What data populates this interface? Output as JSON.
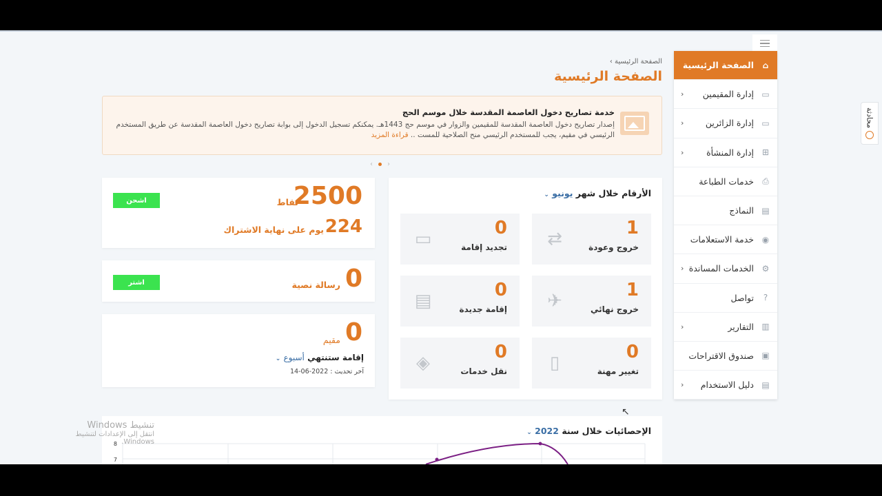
{
  "sidebar": {
    "items": [
      {
        "label": "الصفحة الرئيسية",
        "icon": "home-icon",
        "active": true,
        "chevron": false
      },
      {
        "label": "إدارة المقيمين",
        "icon": "id-card-icon",
        "chevron": true
      },
      {
        "label": "إدارة الزائرين",
        "icon": "id-card-icon",
        "chevron": true
      },
      {
        "label": "إدارة المنشأة",
        "icon": "org-chart-icon",
        "chevron": true
      },
      {
        "label": "خدمات الطباعة",
        "icon": "printer-icon",
        "chevron": false
      },
      {
        "label": "النماذج",
        "icon": "document-icon",
        "chevron": false
      },
      {
        "label": "خدمة الاستعلامات",
        "icon": "eye-icon",
        "chevron": false
      },
      {
        "label": "الخدمات المساندة",
        "icon": "gears-icon",
        "chevron": true
      },
      {
        "label": "تواصل",
        "icon": "question-icon",
        "chevron": false
      },
      {
        "label": "التقارير",
        "icon": "bar-chart-icon",
        "chevron": true
      },
      {
        "label": "صندوق الاقتراحات",
        "icon": "inbox-icon",
        "chevron": false
      },
      {
        "label": "دليل الاستخدام",
        "icon": "book-icon",
        "chevron": true
      }
    ]
  },
  "sidetab": {
    "label": "محادثة"
  },
  "header": {
    "breadcrumb": "الصفحة الرئيسية",
    "breadcrumb_sep": "›",
    "title": "الصفحة الرئيسية"
  },
  "banner": {
    "title": "خدمة تصاريح دخول العاصمة المقدسة خلال موسم الحج",
    "text": "إصدار تصاريح دخول العاصمة المقدسة للمقيمين والزوار في موسم حج 1443هـ. يمكنكم تسجيل الدخول إلى بوابة تصاريح دخول العاصمة المقدسة عن طريق المستخدم الرئيسي في مقيم، يجب للمستخدم الرئيسي منح الصلاحية للمست .. ",
    "more": "قراءة المزيد"
  },
  "points_card": {
    "points": "2500",
    "points_unit": "نقاط",
    "days": "224",
    "days_label": "يوم على نهاية الاشتراك",
    "button": "اشحن"
  },
  "sms_card": {
    "count": "0",
    "label": "رسالة نصية",
    "button": "اشتر"
  },
  "residency_card": {
    "count": "0",
    "label": "مقيم",
    "expiry_label": "إقامة ستنتهي",
    "period": "أسبوع",
    "updated": "آخر تحديث : 2022-06-14"
  },
  "stats": {
    "title": "الأرقام خلال شهر",
    "month": "يونيو",
    "tiles": [
      {
        "value": "1",
        "label": "خروج وعودة",
        "icon": "repeat-icon"
      },
      {
        "value": "0",
        "label": "تجديد إقامة",
        "icon": "id-card-icon"
      },
      {
        "value": "1",
        "label": "خروج نهائي",
        "icon": "airplane-icon"
      },
      {
        "value": "0",
        "label": "إقامة جديدة",
        "icon": "document-icon"
      },
      {
        "value": "0",
        "label": "تغيير مهنة",
        "icon": "badge-icon"
      },
      {
        "value": "0",
        "label": "نقل خدمات",
        "icon": "direction-icon"
      }
    ]
  },
  "yearly": {
    "title": "الإحصائيات خلال سنة",
    "year": "2022",
    "y_ticks": [
      "8",
      "7"
    ]
  },
  "watermark": {
    "line1": "تنشيط Windows",
    "line2": "انتقل إلى الإعدادات لتنشيط Windows."
  }
}
